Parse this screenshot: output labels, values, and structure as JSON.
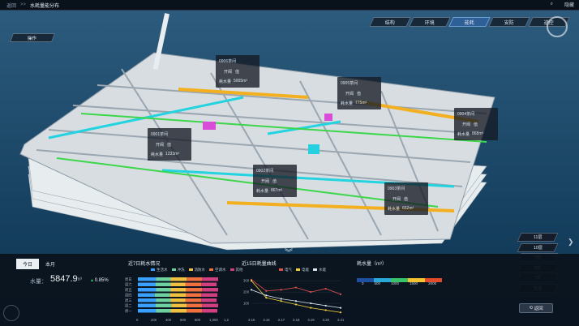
{
  "header": {
    "breadcrumb": "返回",
    "separator": ">>",
    "title": "水耗量能分布",
    "right_label": "隐藏"
  },
  "tabs": [
    {
      "label": "结构",
      "active": false
    },
    {
      "label": "环境",
      "active": false
    },
    {
      "label": "能耗",
      "active": true
    },
    {
      "label": "安防",
      "active": false
    },
    {
      "label": "巡控",
      "active": false
    }
  ],
  "ops_button": "操作",
  "rooms": [
    {
      "name": "0906茶间",
      "open_label": "开阀",
      "value": "值",
      "water_label": "耗水量",
      "water_value": "5005m³"
    },
    {
      "name": "0905茶间",
      "open_label": "开阀",
      "value": "值",
      "water_label": "耗水量",
      "water_value": "775m³"
    },
    {
      "name": "0904茶间",
      "open_label": "开阀",
      "value": "值",
      "water_label": "耗水量",
      "water_value": "868m³"
    },
    {
      "name": "0901茶间",
      "open_label": "开阀",
      "value": "值",
      "water_label": "耗水量",
      "water_value": "1233m³"
    },
    {
      "name": "0902茶间",
      "open_label": "开阀",
      "value": "值",
      "water_label": "耗水量",
      "water_value": "867m³"
    },
    {
      "name": "0903茶间",
      "open_label": "开阀",
      "value": "值",
      "water_label": "耗水量",
      "water_value": "652m³"
    }
  ],
  "floors": [
    "11层",
    "10层",
    "9层",
    "8层",
    "7层",
    "全楼"
  ],
  "stats": {
    "tabs": [
      "今日",
      "本月"
    ],
    "water_label": "水量：",
    "water_value": "5847.9",
    "water_unit": "m³",
    "change": "0.85%"
  },
  "chart_data": [
    {
      "type": "bar",
      "title": "近7日耗水情况",
      "series_names": [
        "生活水",
        "冲洗",
        "消防水",
        "空调水",
        "其他"
      ],
      "categories": [
        "周日",
        "周六",
        "周五",
        "周四",
        "周三",
        "周二",
        "周一"
      ],
      "colors": [
        "#3aa0ff",
        "#6fd0a0",
        "#f0c040",
        "#f07040",
        "#d04080"
      ],
      "xticks": [
        "0",
        "200",
        "400",
        "600",
        "800",
        "1,000",
        "1,200"
      ],
      "values": [
        [
          250,
          200,
          220,
          210,
          220
        ],
        [
          240,
          210,
          200,
          220,
          210
        ],
        [
          250,
          200,
          210,
          220,
          220
        ],
        [
          230,
          210,
          220,
          210,
          220
        ],
        [
          250,
          200,
          200,
          220,
          210
        ],
        [
          240,
          220,
          210,
          210,
          220
        ],
        [
          250,
          200,
          220,
          210,
          210
        ]
      ]
    },
    {
      "type": "line",
      "title": "近15日耗量曲线",
      "series": [
        {
          "name": "电气",
          "color": "#e05050",
          "values": [
            310,
            210,
            220,
            240,
            200,
            230,
            180
          ]
        },
        {
          "name": "电能",
          "color": "#f0d040",
          "values": [
            300,
            150,
            120,
            90,
            60,
            40,
            20
          ]
        },
        {
          "name": "水能",
          "color": "#dce8f2",
          "values": [
            220,
            170,
            140,
            120,
            100,
            80,
            60
          ]
        }
      ],
      "x": [
        "3.15",
        "3.16",
        "3.17",
        "3.18",
        "3.19",
        "3.20",
        "3.21"
      ],
      "yticks": [
        "100",
        "200",
        "300"
      ]
    },
    {
      "type": "heatmap",
      "title": "耗水量（m³）",
      "ticks": [
        "0",
        "500",
        "1000",
        "1500",
        "2000"
      ],
      "colors": [
        "#1e4fa0",
        "#2aa8d8",
        "#39c46a",
        "#f2c230",
        "#e24a2a"
      ]
    }
  ],
  "return_button": "返回",
  "colors": {
    "accent": "#2f5f97",
    "bg": "#0d2f48"
  }
}
